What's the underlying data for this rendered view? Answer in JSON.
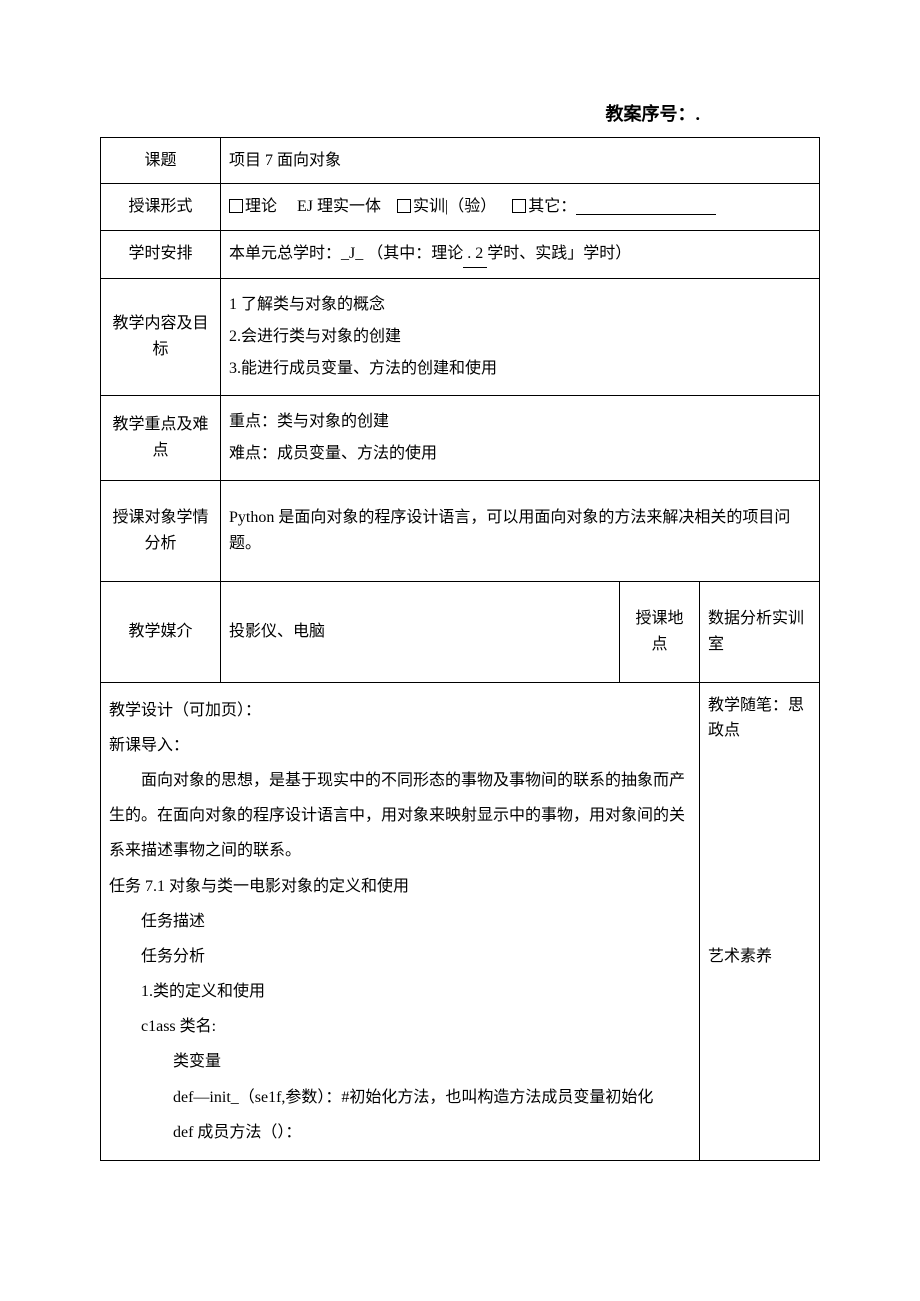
{
  "header": {
    "sequence_label": "教案序号：."
  },
  "rows": {
    "topic": {
      "label": "课题",
      "value": "项目 7 面向对象"
    },
    "teach_form": {
      "label": "授课形式",
      "opt_theory": "理论",
      "opt_integrated_prefix": "EJ",
      "opt_integrated": "理实一体",
      "opt_training": "实训|（验）",
      "opt_other": "其它："
    },
    "schedule": {
      "label": "学时安排",
      "prefix": "本单元总学时：",
      "total_blank": "_J_",
      "mid": "（其中：理论",
      "theory_hours": ". 2",
      "mid2": "学时、实践",
      "practice_blank": "」",
      "suffix": "学时）"
    },
    "content_goal": {
      "label": "教学内容及目标",
      "l1": "1 了解类与对象的概念",
      "l2": "2.会进行类与对象的创建",
      "l3": "3.能进行成员变量、方法的创建和使用"
    },
    "key_difficulty": {
      "label": "教学重点及难点",
      "l1": "重点：类与对象的创建",
      "l2": "难点：成员变量、方法的使用"
    },
    "learner": {
      "label": "授课对象学情分析",
      "value": "Python 是面向对象的程序设计语言，可以用面向对象的方法来解决相关的项目问题。"
    },
    "media": {
      "label": "教学媒介",
      "value": "投影仪、电脑",
      "location_label": "授课地点",
      "location_value": "数据分析实训室"
    }
  },
  "design": {
    "title": "教学设计（可加页）：",
    "intro_heading": "新课导入：",
    "intro_text": "面向对象的思想，是基于现实中的不同形态的事物及事物间的联系的抽象而产生的。在面向对象的程序设计语言中，用对象来映射显示中的事物，用对象间的关系来描述事物之间的联系。",
    "task_heading": "任务 7.1 对象与类一电影对象的定义和使用",
    "task_desc": "任务描述",
    "task_analyze": "任务分析",
    "class_def_title": "1.类的定义和使用",
    "class_line": "c1ass 类名:",
    "classvar_line": "类变量",
    "init_line": "def—init_（se1f,参数）：#初始化方法，也叫构造方法成员变量初始化",
    "method_line": "def 成员方法（）："
  },
  "notes": {
    "heading": "教学随笔：思政点",
    "item1": "艺术素养"
  }
}
